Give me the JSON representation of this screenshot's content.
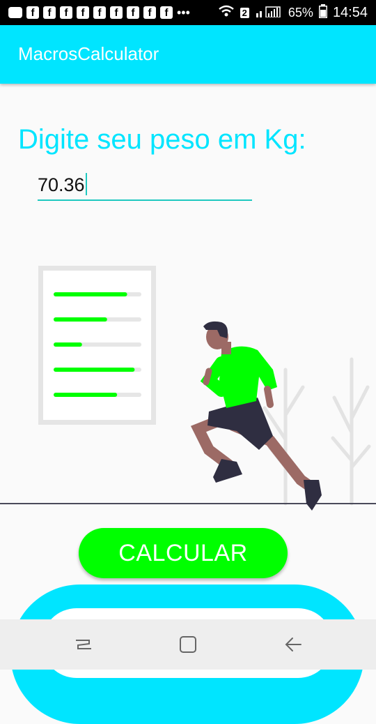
{
  "status_bar": {
    "battery": "65%",
    "time": "14:54",
    "notification_icons": [
      "message-icon",
      "facebook-icon",
      "facebook-icon",
      "facebook-icon",
      "facebook-icon",
      "facebook-icon",
      "facebook-icon",
      "facebook-icon",
      "facebook-icon",
      "facebook-icon",
      "more-icon"
    ],
    "sim_badge": "2"
  },
  "app_bar": {
    "title": "MacrosCalculator"
  },
  "main": {
    "prompt": "Digite seu peso em Kg:",
    "weight_input": {
      "value": "70.36"
    },
    "illustration": {
      "name": "runner-illustration",
      "progress_levels": [
        0.83,
        0.59,
        0.29,
        0.92,
        0.71
      ],
      "accent": "#00ff00"
    },
    "calculate_button": "CALCULAR"
  },
  "colors": {
    "primary": "#00e5ff",
    "accent": "#00ff00",
    "underline": "#1ec8c0"
  },
  "nav_bar": {
    "icons": [
      "recent-apps-icon",
      "home-icon",
      "back-icon"
    ]
  }
}
